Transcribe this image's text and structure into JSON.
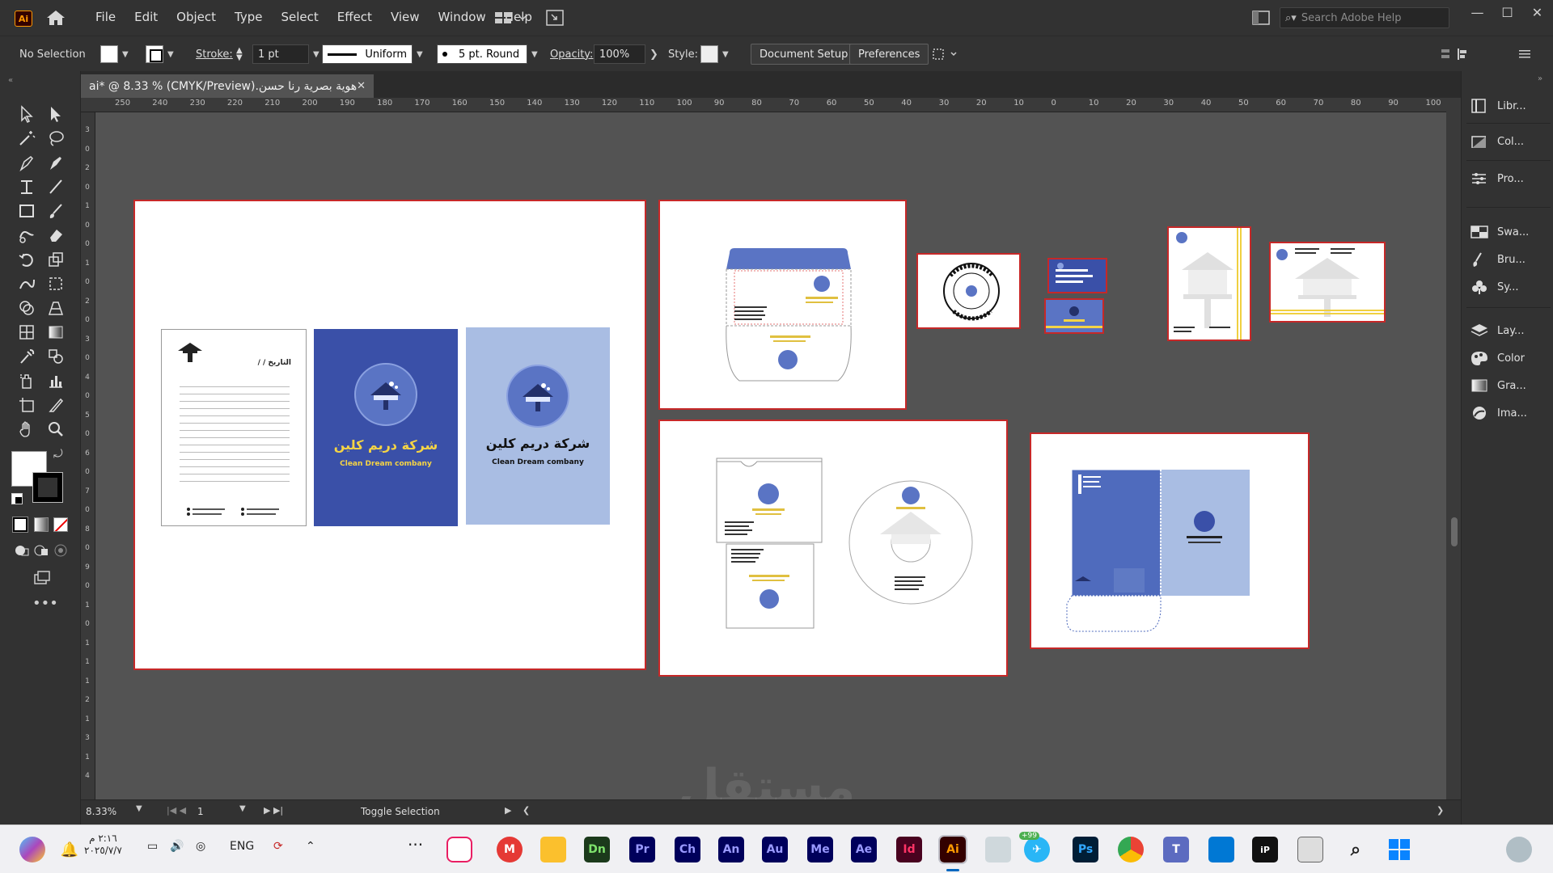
{
  "app": {
    "logo": "Ai",
    "menus": [
      "File",
      "Edit",
      "Object",
      "Type",
      "Select",
      "Effect",
      "View",
      "Window",
      "Help"
    ],
    "search_placeholder": "Search Adobe Help",
    "window_controls": [
      "—",
      "☐",
      "✕"
    ]
  },
  "control_bar": {
    "selection": "No Selection",
    "stroke_label": "Stroke:",
    "stroke_value": "1 pt",
    "profile_label": "Uniform",
    "brush_label": "5 pt. Round",
    "opacity_label": "Opacity:",
    "opacity_value": "100%",
    "style_label": "Style:",
    "document_setup": "Document Setup",
    "preferences": "Preferences"
  },
  "document": {
    "tab_title": "هوية بصرية رنا حسن.ai* @ 8.33 % (CMYK/Preview)",
    "close": "✕"
  },
  "rulers": {
    "h_labels": [
      "250",
      "240",
      "230",
      "220",
      "210",
      "200",
      "190",
      "180",
      "170",
      "160",
      "150",
      "140",
      "130",
      "120",
      "110",
      "100",
      "90",
      "80",
      "70",
      "60",
      "50",
      "40",
      "30",
      "20",
      "10",
      "0",
      "10",
      "20",
      "30",
      "40",
      "50",
      "60",
      "70",
      "80",
      "90",
      "100"
    ],
    "v_labels": [
      "3",
      "0",
      "2",
      "0",
      "1",
      "0",
      "0",
      "1",
      "0",
      "2",
      "0",
      "3",
      "0",
      "4",
      "0",
      "5",
      "0",
      "6",
      "0",
      "7",
      "0",
      "8",
      "0",
      "9",
      "0",
      "1",
      "0",
      "1",
      "1",
      "1",
      "2",
      "1",
      "3",
      "1",
      "4"
    ]
  },
  "artwork": {
    "company_ar": "شركة دريم كلين",
    "company_en": "Clean Dream combany",
    "letter_date": "التاريخ / /"
  },
  "right_panels": [
    {
      "label": "Libr...",
      "icon": "libraries-icon"
    },
    {
      "label": "Col...",
      "icon": "color-guide-icon"
    },
    {
      "label": "Pro...",
      "icon": "properties-icon"
    },
    {
      "label": "Swa...",
      "icon": "swatches-icon"
    },
    {
      "label": "Bru...",
      "icon": "brushes-icon"
    },
    {
      "label": "Sy...",
      "icon": "symbols-icon"
    },
    {
      "label": "Lay...",
      "icon": "layers-icon"
    },
    {
      "label": "Color",
      "icon": "color-icon"
    },
    {
      "label": "Gra...",
      "icon": "gradient-icon"
    },
    {
      "label": "Ima...",
      "icon": "image-trace-icon"
    }
  ],
  "status": {
    "zoom": "8.33%",
    "artboard_num": "1",
    "toggle_selection": "Toggle Selection"
  },
  "taskbar": {
    "apps": [
      "Dn",
      "Pr",
      "Ch",
      "An",
      "Au",
      "Me",
      "Ae",
      "Id",
      "Ai",
      "Ps"
    ],
    "notification_badge": "+99",
    "language": "ENG",
    "time": "٢:١٦ م",
    "date": "٢٠٢٥/٧/٧"
  },
  "watermark": "مستقل"
}
